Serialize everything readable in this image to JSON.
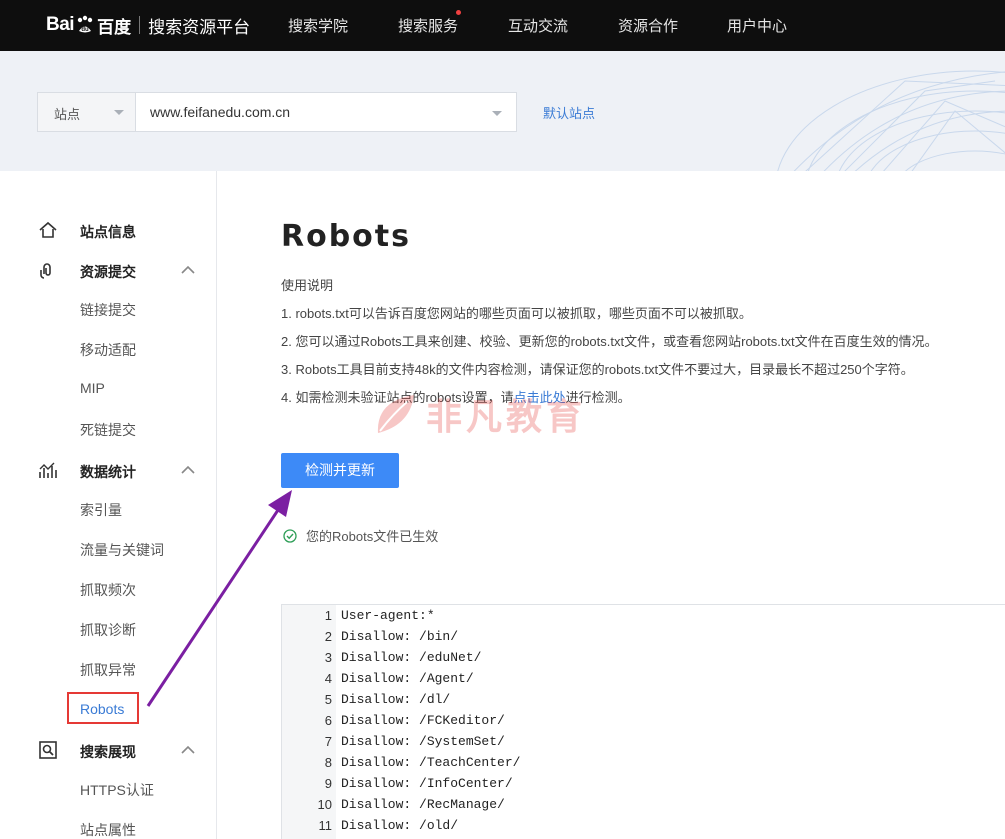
{
  "topnav": {
    "logo_bai": "Bai",
    "logo_du": "du",
    "logo_cn": "百度",
    "platform": "搜索资源平台",
    "items": [
      "搜索学院",
      "搜索服务",
      "互动交流",
      "资源合作",
      "用户中心"
    ]
  },
  "banner": {
    "site_type": "站点",
    "site_url": "www.feifanedu.com.cn",
    "default_site": "默认站点"
  },
  "sidebar": {
    "site_info": "站点信息",
    "resource_submit": {
      "label": "资源提交",
      "items": [
        "链接提交",
        "移动适配",
        "MIP",
        "死链提交"
      ]
    },
    "data_stats": {
      "label": "数据统计",
      "items": [
        "索引量",
        "流量与关键词",
        "抓取频次",
        "抓取诊断",
        "抓取异常",
        "Robots"
      ]
    },
    "search_display": {
      "label": "搜索展现",
      "items": [
        "HTTPS认证",
        "站点属性"
      ]
    }
  },
  "main": {
    "title": "Robots",
    "intro_head": "使用说明",
    "intro_lines": [
      "1. robots.txt可以告诉百度您网站的哪些页面可以被抓取，哪些页面不可以被抓取。",
      "2. 您可以通过Robots工具来创建、校验、更新您的robots.txt文件，或查看您网站robots.txt文件在百度生效的情况。",
      "3. Robots工具目前支持48k的文件内容检测，请保证您的robots.txt文件不要过大，目录最长不超过250个字符。"
    ],
    "intro_line4_pre": "4. 如需检测未验证站点的robots设置，请",
    "intro_line4_link": "点击此处",
    "intro_line4_post": "进行检测。",
    "watermark": "非凡教育",
    "check_button": "检测并更新",
    "status": "您的Robots文件已生效"
  },
  "robots_file": {
    "lines": [
      {
        "n": "1",
        "text": "User-agent:*"
      },
      {
        "n": "2",
        "text": "Disallow: /bin/"
      },
      {
        "n": "3",
        "text": "Disallow: /eduNet/"
      },
      {
        "n": "4",
        "text": "Disallow: /Agent/"
      },
      {
        "n": "5",
        "text": "Disallow: /dl/"
      },
      {
        "n": "6",
        "text": "Disallow: /FCKeditor/"
      },
      {
        "n": "7",
        "text": "Disallow: /SystemSet/"
      },
      {
        "n": "8",
        "text": "Disallow: /TeachCenter/"
      },
      {
        "n": "9",
        "text": "Disallow: /InfoCenter/"
      },
      {
        "n": "10",
        "text": "Disallow: /RecManage/"
      },
      {
        "n": "11",
        "text": "Disallow: /old/"
      }
    ]
  },
  "colors": {
    "nav_bg": "#0e0e0e",
    "accent": "#3d8af7",
    "link": "#3a7bd5",
    "highlight_box": "#e53935",
    "annotation_arrow": "#7b1fa2",
    "status_ok": "#2e9e57"
  }
}
